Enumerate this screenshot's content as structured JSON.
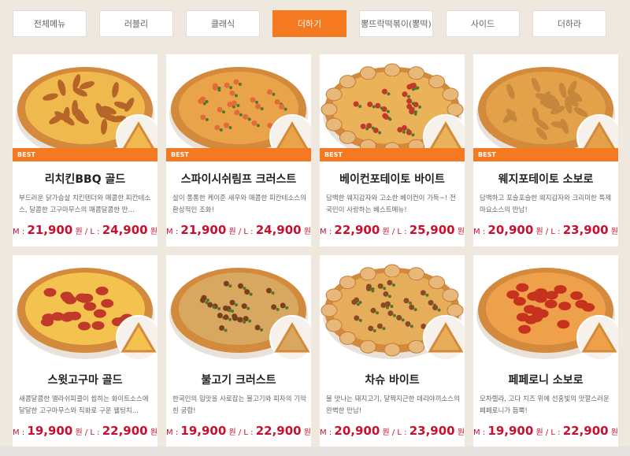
{
  "tabs": [
    {
      "label": "전체메뉴"
    },
    {
      "label": "러블리"
    },
    {
      "label": "클래식"
    },
    {
      "label": "더하기"
    },
    {
      "label": "뽕뜨락떡볶이(뽕떡)"
    },
    {
      "label": "사이드"
    },
    {
      "label": "더하라"
    }
  ],
  "active_tab": "더하기",
  "products": [
    {
      "name": "리치킨BBQ 골드",
      "badge": "BEST",
      "desc": "부드러운 닭가슴살 치킨텐더와 매콤한 피칸테소스, 달콤한 고구마무스의 매콤달콤한 만...",
      "m_label": "M :",
      "m_price": "21,900",
      "l_label": "원 / L :",
      "l_price": "24,900",
      "unit": "원",
      "topping": "chicken"
    },
    {
      "name": "스파이시쉬림프 크러스트",
      "badge": "BEST",
      "desc": "살이 통통한 케이준 새우와 매콤한 피칸테소스의 환상적인 조화!",
      "m_label": "M :",
      "m_price": "21,900",
      "l_label": "원 / L :",
      "l_price": "24,900",
      "unit": "원",
      "topping": "shrimp"
    },
    {
      "name": "베이컨포테이토 바이트",
      "badge": "BEST",
      "desc": "담백한 웨지감자와 고소한 베이컨이 가득~! 전국민이 사랑하는 베스트메뉴!",
      "m_label": "M :",
      "m_price": "22,900",
      "l_label": "원 / L :",
      "l_price": "25,900",
      "unit": "원",
      "topping": "bite"
    },
    {
      "name": "웨지포테이토 소보로",
      "badge": "BEST",
      "desc": "담백하고 포슬포슬한 웨지감자와 크리미한 특제마요소스의 만남!",
      "m_label": "M :",
      "m_price": "20,900",
      "l_label": "원 / L :",
      "l_price": "23,900",
      "unit": "원",
      "topping": "wedge"
    },
    {
      "name": "스윗고구마 골드",
      "badge": "",
      "desc": "새콤달콤한 멜라쉬피클이 씹히는 화이트소스에 달달한 고구마무스와 직화로 구운 웰팅치...",
      "m_label": "M :",
      "m_price": "19,900",
      "l_label": "원 / L :",
      "l_price": "22,900",
      "unit": "원",
      "topping": "sweet"
    },
    {
      "name": "불고기 크러스트",
      "badge": "",
      "desc": "한국인의 입맛을 사로잡는 불고기와 피자의 기막힌 궁합!",
      "m_label": "M :",
      "m_price": "19,900",
      "l_label": "원 / L :",
      "l_price": "22,900",
      "unit": "원",
      "topping": "bulgogi"
    },
    {
      "name": "차슈 바이트",
      "badge": "",
      "desc": "불 맛나는 돼지고기, 달짝지근한 데리야끼소스의 완벽한 만남!",
      "m_label": "M :",
      "m_price": "20,900",
      "l_label": "원 / L :",
      "l_price": "23,900",
      "unit": "원",
      "topping": "chashu"
    },
    {
      "name": "페페로니 소보로",
      "badge": "",
      "desc": "모차렐라, 고다 치즈 위에 선홍빛의 맛깔스러운 페페로니가 듬뿍!",
      "m_label": "M :",
      "m_price": "19,900",
      "l_label": "원 / L :",
      "l_price": "22,900",
      "unit": "원",
      "topping": "pepperoni"
    }
  ],
  "colors": {
    "accent": "#f47920",
    "price": "#c8102e",
    "background": "#efe8de"
  }
}
